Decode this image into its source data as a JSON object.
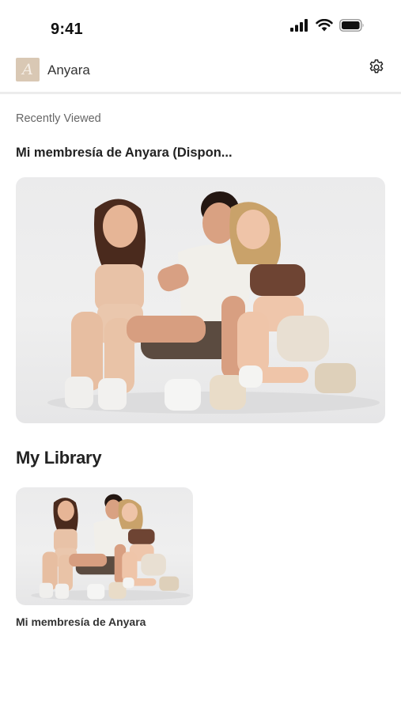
{
  "status_bar": {
    "time": "9:41",
    "icons": [
      "cellular-signal-icon",
      "wifi-icon",
      "battery-icon"
    ]
  },
  "header": {
    "logo_letter": "A",
    "brand_name": "Anyara",
    "settings_icon": "gear-icon"
  },
  "recently_viewed": {
    "caption": "Recently Viewed",
    "title": "Mi membresía de Anyara (Dispon...",
    "image_alt": "Three people in athletic wear sitting on the floor"
  },
  "library": {
    "heading": "My Library",
    "items": [
      {
        "title": "Mi membresía de Anyara",
        "image_alt": "Three people in athletic wear sitting on the floor"
      }
    ]
  },
  "colors": {
    "background": "#ffffff",
    "divider": "#ececec",
    "logo_background": "#d9c8b4",
    "text_primary": "#222222",
    "text_secondary": "#666666"
  }
}
